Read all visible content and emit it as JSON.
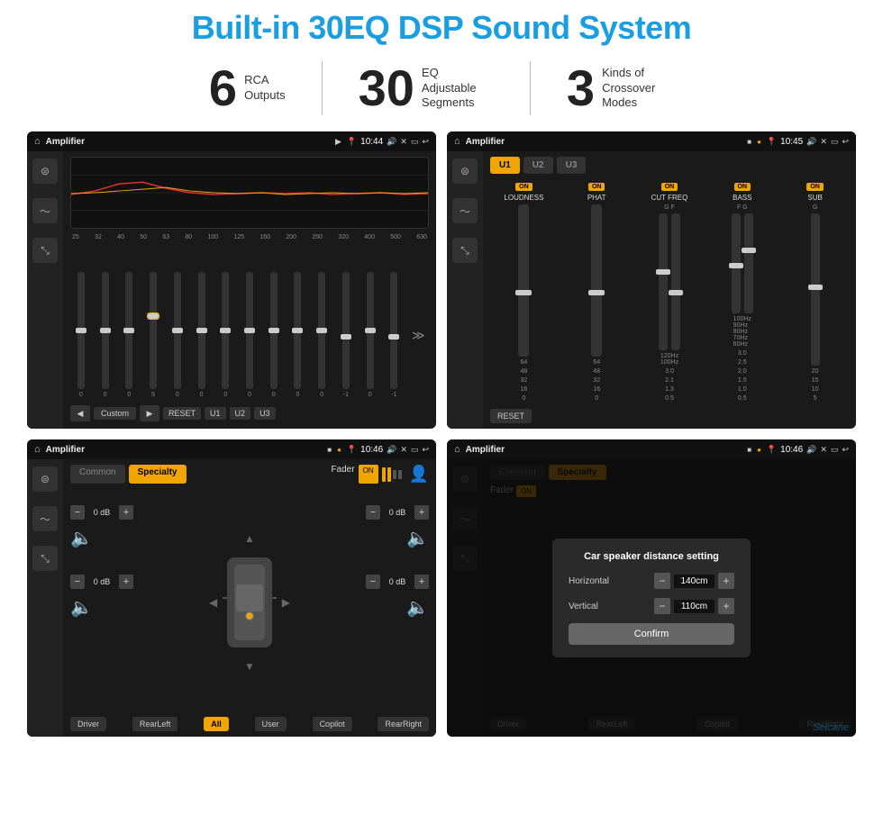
{
  "page": {
    "title": "Built-in 30EQ DSP Sound System",
    "stats": [
      {
        "number": "6",
        "label": "RCA\nOutputs"
      },
      {
        "number": "30",
        "label": "EQ Adjustable\nSegments"
      },
      {
        "number": "3",
        "label": "Kinds of\nCrossover Modes"
      }
    ]
  },
  "screens": {
    "screen1": {
      "app": "Amplifier",
      "time": "10:44",
      "freq_labels": [
        "25",
        "32",
        "40",
        "50",
        "63",
        "80",
        "100",
        "125",
        "160",
        "200",
        "250",
        "320",
        "400",
        "500",
        "630"
      ],
      "slider_vals": [
        "0",
        "0",
        "0",
        "5",
        "0",
        "0",
        "0",
        "0",
        "0",
        "0",
        "0",
        "-1",
        "0",
        "-1"
      ],
      "presets": [
        "Custom",
        "RESET",
        "U1",
        "U2",
        "U3"
      ]
    },
    "screen2": {
      "app": "Amplifier",
      "time": "10:45",
      "presets": [
        "U1",
        "U2",
        "U3"
      ],
      "controls": [
        {
          "label": "LOUDNESS",
          "on": true,
          "val": ""
        },
        {
          "label": "PHAT",
          "on": true,
          "val": ""
        },
        {
          "label": "CUT FREQ",
          "on": true,
          "sublabel": "G  F",
          "val": "3.0"
        },
        {
          "label": "BASS",
          "on": true,
          "sublabel": "F  G",
          "val": "3.0"
        },
        {
          "label": "SUB",
          "on": true,
          "sublabel": "G",
          "val": ""
        }
      ],
      "reset": "RESET"
    },
    "screen3": {
      "app": "Amplifier",
      "time": "10:46",
      "tabs": [
        "Common",
        "Specialty"
      ],
      "fader_label": "Fader",
      "on_label": "ON",
      "zones": {
        "top_left": "0 dB",
        "top_right": "0 dB",
        "bot_left": "0 dB",
        "bot_right": "0 dB"
      },
      "buttons": [
        "Driver",
        "RearLeft",
        "All",
        "User",
        "Copilot",
        "RearRight"
      ]
    },
    "screen4": {
      "app": "Amplifier",
      "time": "10:46",
      "tabs": [
        "Common",
        "Specialty"
      ],
      "dialog": {
        "title": "Car speaker distance setting",
        "horizontal_label": "Horizontal",
        "horizontal_value": "140cm",
        "vertical_label": "Vertical",
        "vertical_value": "110cm",
        "confirm_label": "Confirm"
      },
      "buttons": [
        "Driver",
        "RearLeft",
        "Copilot",
        "RearRight"
      ]
    }
  },
  "watermark": "Seicane"
}
